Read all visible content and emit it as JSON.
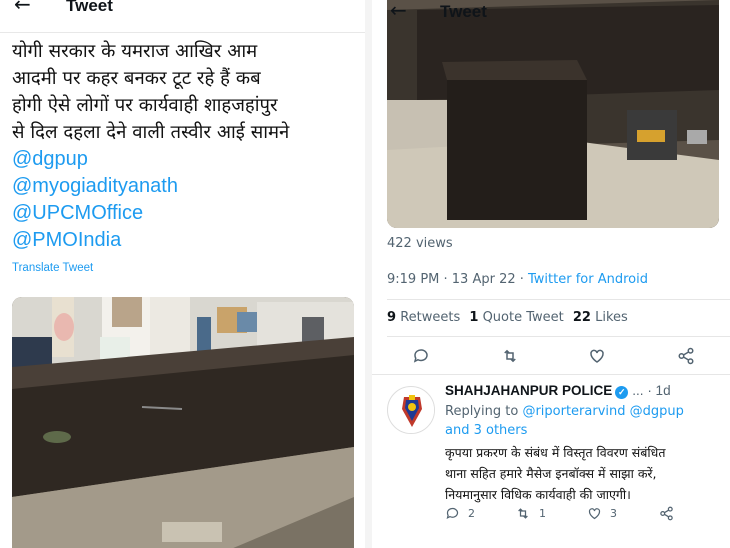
{
  "left": {
    "header_title": "Tweet",
    "tweet_lines": [
      "योगी सरकार के यमराज आखिर आम",
      "आदमी पर कहर बनकर टूट रहे हैं कब",
      "होगी ऐसे लोगों पर कार्यवाही शाहजहांपुर",
      "से दिल दहला देने वाली तस्वीर आई सामने"
    ],
    "mentions": [
      "@dgpup",
      "@myogiadityanath",
      "@UPCMOffice",
      "@PMOIndia"
    ],
    "translate_label": "Translate Tweet"
  },
  "right": {
    "header_title": "Tweet",
    "views": "422 views",
    "time": "9:19 PM · 13 Apr 22 · ",
    "source": "Twitter for Android",
    "stats": {
      "retweets_count": "9",
      "retweets_label": "Retweets",
      "quotes_count": "1",
      "quotes_label": "Quote Tweet",
      "likes_count": "22",
      "likes_label": "Likes"
    },
    "reply": {
      "name": "SHAHJAHANPUR POLICE",
      "handle": "...",
      "time": "· 1d",
      "replying_prefix": "Replying to ",
      "replying_users": "@riporterarvind @dgpup",
      "replying_more": "and 3 others",
      "body_lines": [
        "कृपया प्रकरण के संबंध में विस्तृत विवरण संबंधित",
        "थाना सहित हमारे मैसेज इनबॉक्स में साझा करें,",
        "नियमानुसार विधिक कार्यवाही की जाएगी।"
      ],
      "reply_count": "2",
      "retweet_count": "1",
      "like_count": "3"
    }
  },
  "colors": {
    "accent": "#1d9bf0",
    "muted": "#536471",
    "text": "#0f1419"
  }
}
